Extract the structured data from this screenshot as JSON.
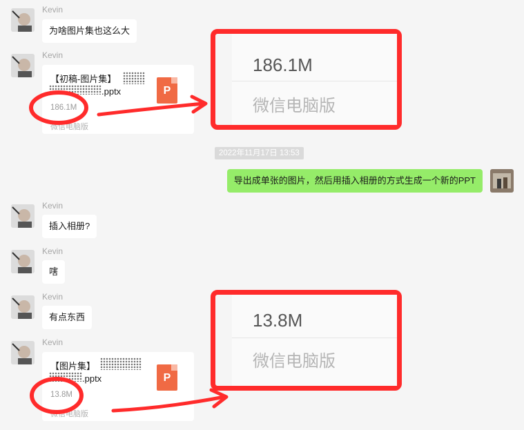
{
  "colors": {
    "background": "#f5f5f5",
    "bubble_white": "#ffffff",
    "bubble_green": "#95ec69",
    "annotation_red": "#ff2b2b",
    "ppt_orange": "#f06a44"
  },
  "messages": [
    {
      "sender": "Kevin",
      "type": "text",
      "text": "为啥图片集也这么大"
    },
    {
      "sender": "Kevin",
      "type": "file",
      "file_name_line1": "【初稿-图片集】",
      "file_name_line2": ".pptx",
      "file_size": "186.1M",
      "file_source": "微信电脑版",
      "file_icon": "P"
    },
    {
      "type": "timestamp",
      "text": "2022年11月17日 13:53"
    },
    {
      "sender": "me",
      "type": "text",
      "text": "导出成单张的图片，然后用插入相册的方式生成一个新的PPT"
    },
    {
      "sender": "Kevin",
      "type": "text",
      "text": "插入相册?"
    },
    {
      "sender": "Kevin",
      "type": "text",
      "text": "嗐"
    },
    {
      "sender": "Kevin",
      "type": "text",
      "text": "有点东西"
    },
    {
      "sender": "Kevin",
      "type": "file",
      "file_name_line1": "【图片集】",
      "file_name_line2": ".pptx",
      "file_size": "13.8M",
      "file_source": "微信电脑版",
      "file_icon": "P"
    }
  ],
  "zoom_callouts": [
    {
      "size": "186.1M",
      "source": "微信电脑版"
    },
    {
      "size": "13.8M",
      "source": "微信电脑版"
    }
  ]
}
